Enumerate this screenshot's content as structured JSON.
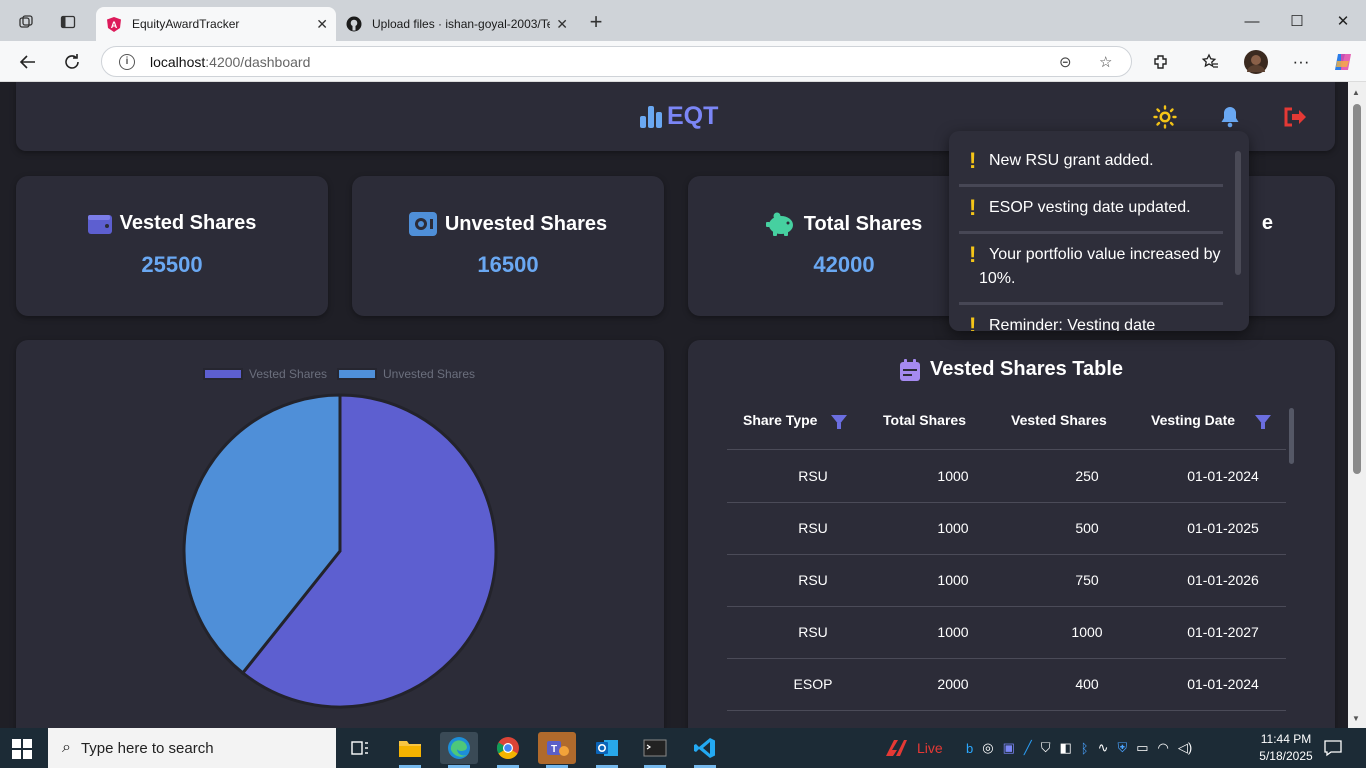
{
  "browser": {
    "tabs": [
      {
        "title": "EquityAwardTracker",
        "active": true
      },
      {
        "title": "Upload files · ishan-goyal-2003/Te",
        "active": false
      }
    ],
    "address": {
      "host": "localhost",
      "path": ":4200/dashboard"
    }
  },
  "header": {
    "logo_text": "EQT"
  },
  "stats": [
    {
      "label": "Vested Shares",
      "value": "25500",
      "icon": "wallet-icon"
    },
    {
      "label": "Unvested Shares",
      "value": "16500",
      "icon": "safe-icon"
    },
    {
      "label": "Total Shares",
      "value": "42000",
      "icon": "piggy-bank-icon"
    },
    {
      "label": "e",
      "value": "",
      "icon": ""
    }
  ],
  "notifications": [
    {
      "text": "New RSU grant added."
    },
    {
      "text": "ESOP vesting date updated."
    },
    {
      "text": "Your portfolio value increased by 10%."
    },
    {
      "text": "Reminder: Vesting date"
    }
  ],
  "chart_data": {
    "type": "pie",
    "labels": [
      "Vested Shares",
      "Unvested Shares"
    ],
    "values": [
      25500,
      16500
    ],
    "colors": [
      "#5d5fd0",
      "#4f8fd8"
    ],
    "legend_position": "top"
  },
  "table": {
    "title": "Vested Shares Table",
    "columns": [
      "Share Type",
      "Total Shares",
      "Vested Shares",
      "Vesting Date"
    ],
    "rows": [
      [
        "RSU",
        "1000",
        "250",
        "01-01-2024"
      ],
      [
        "RSU",
        "1000",
        "500",
        "01-01-2025"
      ],
      [
        "RSU",
        "1000",
        "750",
        "01-01-2026"
      ],
      [
        "RSU",
        "1000",
        "1000",
        "01-01-2027"
      ],
      [
        "ESOP",
        "2000",
        "400",
        "01-01-2024"
      ]
    ]
  },
  "taskbar": {
    "search_placeholder": "Type here to search",
    "live_label": "Live",
    "time": "11:44 PM",
    "date": "5/18/2025"
  },
  "colors": {
    "accent": "#7b86f6",
    "value_blue": "#6aa8f2",
    "card_bg": "#2c2c38",
    "page_bg": "#1f1f26",
    "warning": "#f5c518",
    "logout": "#e53935"
  }
}
